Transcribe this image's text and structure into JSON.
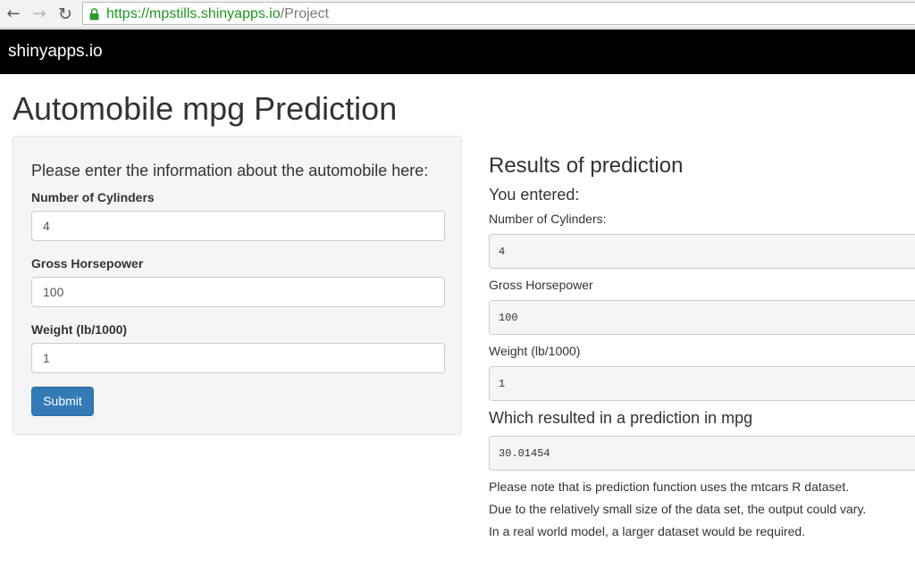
{
  "browser": {
    "url_scheme": "https://",
    "url_host": "mpstills.shinyapps.io",
    "url_path": "/Project"
  },
  "navbar": {
    "brand": "shinyapps.io"
  },
  "page": {
    "title": "Automobile mpg Prediction"
  },
  "form": {
    "heading": "Please enter the information about the automobile here:",
    "cylinders_label": "Number of Cylinders",
    "cylinders_value": "4",
    "horsepower_label": "Gross Horsepower",
    "horsepower_value": "100",
    "weight_label": "Weight (lb/1000)",
    "weight_value": "1",
    "submit_label": "Submit"
  },
  "results": {
    "heading": "Results of prediction",
    "you_entered": "You entered:",
    "cylinders_label": "Number of Cylinders:",
    "cylinders_value": "4",
    "horsepower_label": "Gross Horsepower",
    "horsepower_value": "100",
    "weight_label": "Weight (lb/1000)",
    "weight_value": "1",
    "prediction_heading": "Which resulted in a prediction in mpg",
    "prediction_value": "30.01454",
    "notes": [
      "Please note that is prediction function uses the mtcars R dataset.",
      "Due to the relatively small size of the data set, the output could vary.",
      "In a real world model, a larger dataset would be required."
    ]
  },
  "colors": {
    "navbar_bg": "#000000",
    "primary_button": "#337ab7",
    "secure_url": "#209622",
    "well_bg": "#f5f5f5"
  },
  "icons": [
    "back-arrow-icon",
    "forward-arrow-icon",
    "reload-icon",
    "lock-icon"
  ]
}
